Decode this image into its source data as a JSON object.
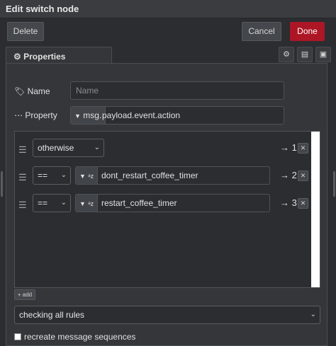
{
  "title": "Edit switch node",
  "buttons": {
    "delete": "Delete",
    "cancel": "Cancel",
    "done": "Done"
  },
  "tabs": [
    {
      "label": "Properties",
      "icon": "gear-icon",
      "active": true
    }
  ],
  "tab_actions": [
    "settings-icon",
    "description-icon",
    "appearance-icon"
  ],
  "form": {
    "name_label": "Name",
    "name_placeholder": "Name",
    "name_value": "",
    "property_label": "Property",
    "property_type": "msg.",
    "property_value": "payload.event.action"
  },
  "rules": [
    {
      "operator": "otherwise",
      "value_type": "",
      "value": "",
      "output": "→ 1"
    },
    {
      "operator": "==",
      "value_type": "az",
      "value": "dont_restart_coffee_timer",
      "output": "→ 2"
    },
    {
      "operator": "==",
      "value_type": "az",
      "value": "restart_coffee_timer",
      "output": "→ 3"
    }
  ],
  "add_label": "+ add",
  "mode_select": "checking all rules",
  "recreate_label": "recreate message sequences",
  "recreate_checked": false,
  "colors": {
    "accent_danger": "#ad1625",
    "background": "#2b2d31",
    "panel": "#34363a"
  }
}
